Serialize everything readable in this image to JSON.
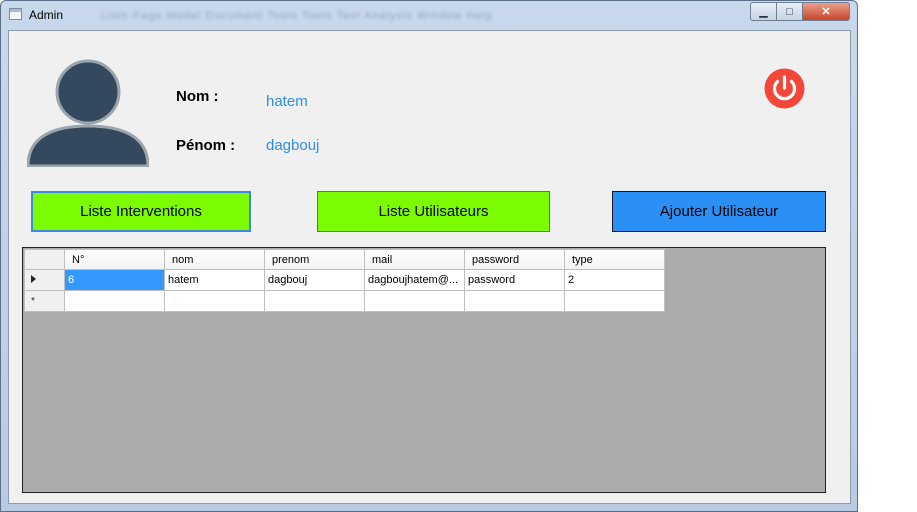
{
  "window": {
    "title": "Admin",
    "blurred_menu": "Lists  Page  Model  Document  Tools  Tools  Test  Analysis  Window  Help",
    "controls": {
      "minimize": "▁",
      "maximize": "□",
      "close": "✕"
    }
  },
  "profile": {
    "nom_label": "Nom :",
    "nom_value": "hatem",
    "prenom_label": "Pénom :",
    "prenom_value": "dagbouj"
  },
  "buttons": {
    "interventions": "Liste Interventions",
    "utilisateurs": "Liste Utilisateurs",
    "ajouter": "Ajouter Utilisateur"
  },
  "colors": {
    "green": "#7cfc00",
    "blue": "#2b90f5",
    "power": "#f4473a",
    "link_text": "#2d8fe6"
  },
  "icons": {
    "user": "user-avatar-icon",
    "power": "power-icon"
  },
  "grid": {
    "columns": [
      "N°",
      "nom",
      "prenom",
      "mail",
      "password",
      "type"
    ],
    "rows": [
      [
        "6",
        "hatem",
        "dagbouj",
        "dagboujhatem@...",
        "password",
        "2"
      ]
    ],
    "new_row_marker": "*"
  }
}
